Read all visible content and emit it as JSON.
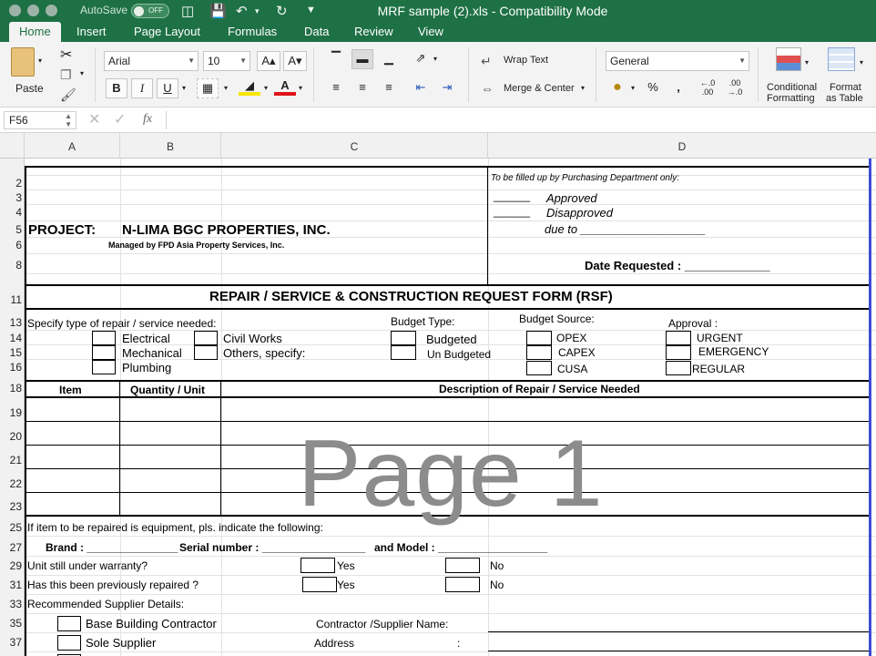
{
  "titlebar": {
    "autosave_label": "AutoSave",
    "autosave_state": "OFF",
    "window_title": "MRF sample (2).xls  -  Compatibility Mode"
  },
  "ribbon_tabs": [
    "Home",
    "Insert",
    "Page Layout",
    "Formulas",
    "Data",
    "Review",
    "View"
  ],
  "ribbon": {
    "paste_label": "Paste",
    "font_name": "Arial",
    "font_size": "10",
    "wrap_text": "Wrap Text",
    "merge_center": "Merge & Center",
    "number_format": "General",
    "conditional_formatting_line1": "Conditional",
    "conditional_formatting_line2": "Formatting",
    "format_table_line1": "Format",
    "format_table_line2": "as Table",
    "percent": "%",
    "comma": ","
  },
  "formula_bar": {
    "cell_ref": "F56",
    "fx_label": "fx",
    "value": ""
  },
  "columns": [
    "A",
    "B",
    "C",
    "D"
  ],
  "rows": [
    "2",
    "3",
    "4",
    "5",
    "6",
    "8",
    "11",
    "13",
    "14",
    "15",
    "16",
    "18",
    "19",
    "20",
    "21",
    "22",
    "23",
    "25",
    "27",
    "29",
    "31",
    "33",
    "35",
    "37"
  ],
  "sheet": {
    "purchasing_note": "To be filled up by Purchasing Department only:",
    "approved_blank": "______",
    "approved": "Approved",
    "disapproved_blank": "______",
    "disapproved": "Disapproved",
    "due_to": "due to ___________________",
    "project_label": "PROJECT:",
    "project_name": "N-LIMA BGC PROPERTIES, INC.",
    "managed_by": "Managed by FPD Asia Property Services, Inc.",
    "date_requested": "Date Requested : _____________",
    "form_title": "REPAIR / SERVICE & CONSTRUCTION REQUEST FORM (RSF)",
    "specify_type": "Specify type of repair / service needed:",
    "budget_type": "Budget Type:",
    "budget_source": "Budget Source:",
    "approval": "Approval :",
    "electrical": "Electrical",
    "civil_works": "Civil Works",
    "budgeted": "Budgeted",
    "opex": "OPEX",
    "urgent": "URGENT",
    "mechanical": "Mechanical",
    "others_specify": "Others, specify:",
    "un_budgeted": "Un Budgeted",
    "capex": "CAPEX",
    "emergency": "EMERGENCY",
    "plumbing": "Plumbing",
    "cusa": "CUSA",
    "regular": "REGULAR",
    "col_item": "Item",
    "col_qty": "Quantity / Unit",
    "col_desc": "Description of Repair / Service Needed",
    "watermark": "Page 1",
    "equipment_note": "If item to be repaired is equipment, pls. indicate the following:",
    "brand": "Brand :  _______________",
    "serial": "Serial number : _________________",
    "model": "and Model : __________________",
    "warranty_q": "Unit still under warranty?",
    "repaired_q": "Has this been previously repaired ?",
    "yes": "Yes",
    "no": "No",
    "supplier_details": "Recommended Supplier Details:",
    "base_building": "Base Building Contractor",
    "sole_supplier": "Sole Supplier",
    "contractor_name": "Contractor /Supplier Name:",
    "address": "Address",
    "colon": ":"
  }
}
